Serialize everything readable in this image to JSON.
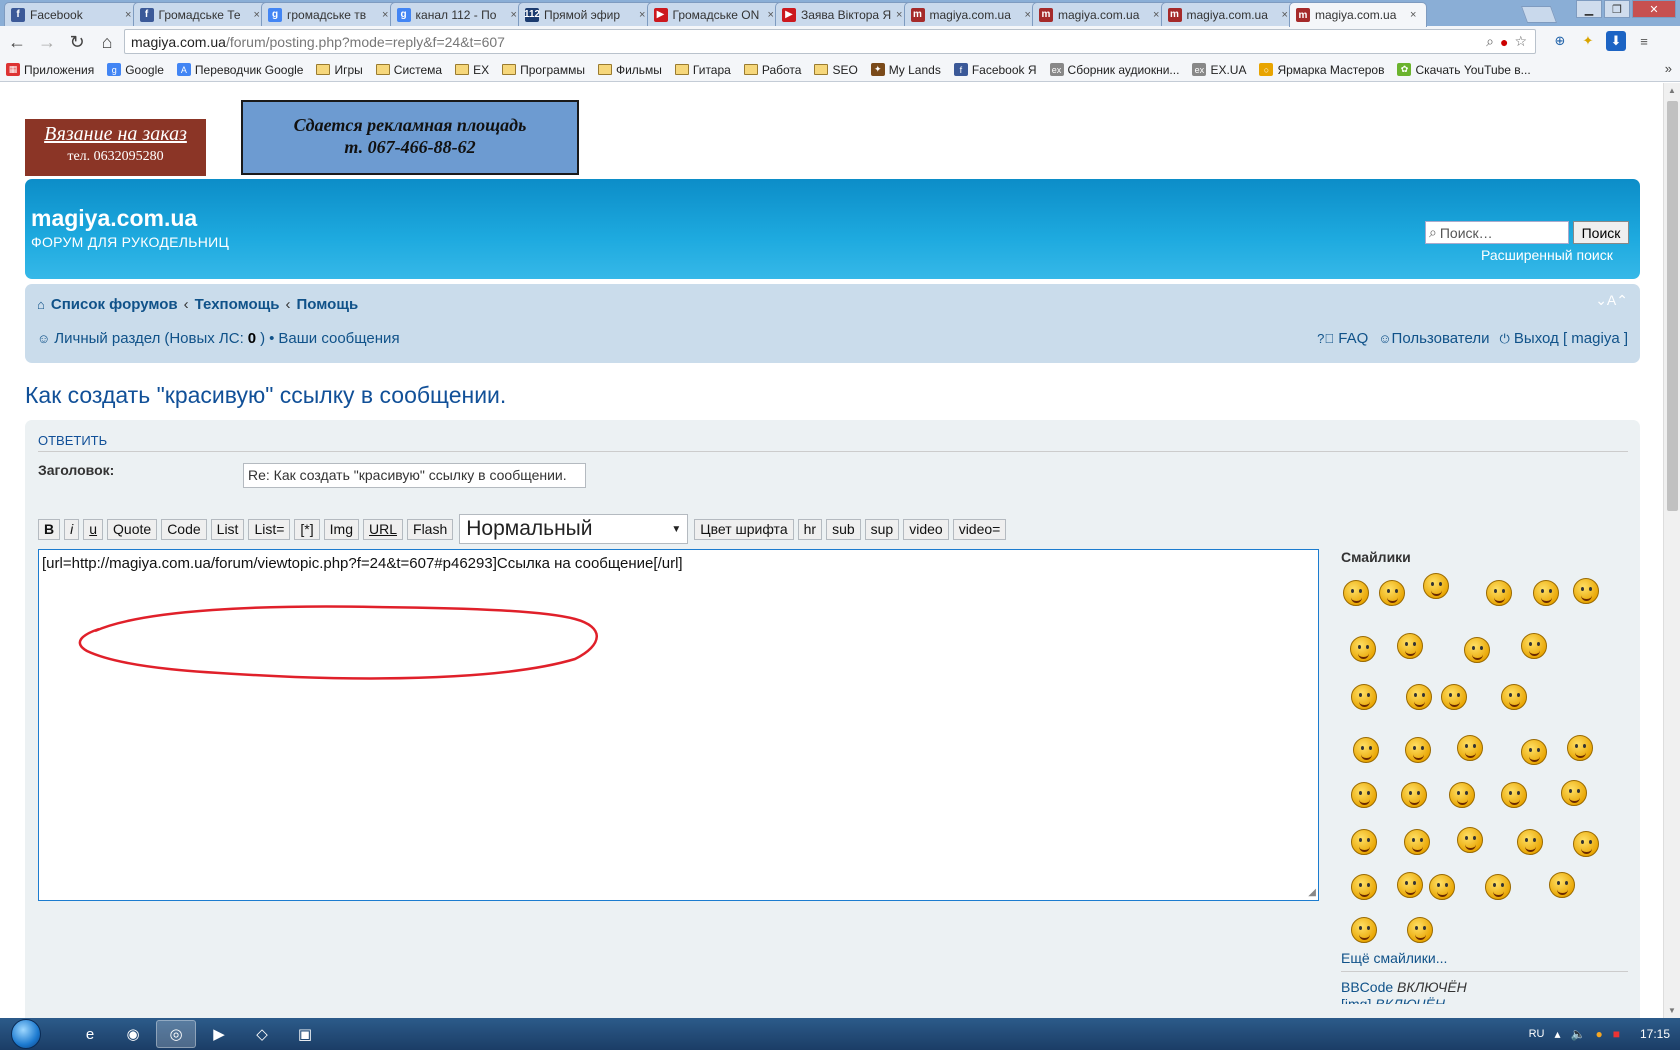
{
  "browser": {
    "tabs": [
      {
        "label": "Facebook",
        "icon": "facebook-icon",
        "color": "#3b5998",
        "glyph": "f"
      },
      {
        "label": "Громадське Те",
        "icon": "facebook-icon",
        "color": "#3b5998",
        "glyph": "f"
      },
      {
        "label": "громадське тв",
        "icon": "google-icon",
        "color": "#4285f4",
        "glyph": "g"
      },
      {
        "label": "канал 112 - По",
        "icon": "google-icon",
        "color": "#4285f4",
        "glyph": "g"
      },
      {
        "label": "Прямой эфир",
        "icon": "channel-112-icon",
        "color": "#1b3b6f",
        "glyph": "112"
      },
      {
        "label": "Громадське ON",
        "icon": "youtube-icon",
        "color": "#cc181e",
        "glyph": "▶"
      },
      {
        "label": "Заява Віктора Я",
        "icon": "youtube-icon",
        "color": "#cc181e",
        "glyph": "▶"
      },
      {
        "label": "magiya.com.ua",
        "icon": "magiya-icon",
        "color": "#a52a2a",
        "glyph": "m"
      },
      {
        "label": "magiya.com.ua",
        "icon": "magiya-icon",
        "color": "#a52a2a",
        "glyph": "m"
      },
      {
        "label": "magiya.com.ua",
        "icon": "magiya-icon",
        "color": "#a52a2a",
        "glyph": "m"
      },
      {
        "label": "magiya.com.ua",
        "icon": "magiya-icon",
        "color": "#a52a2a",
        "glyph": "m",
        "active": true
      }
    ],
    "address": {
      "host": "magiya.com.ua",
      "path": "/forum/posting.php?mode=reply&f=24&t=607"
    },
    "bookmarks": [
      {
        "label": "Приложения",
        "type": "apps"
      },
      {
        "label": "Google",
        "type": "google"
      },
      {
        "label": "Переводчик Google",
        "type": "translate"
      },
      {
        "label": "Игры",
        "type": "folder"
      },
      {
        "label": "Система",
        "type": "folder"
      },
      {
        "label": "EX",
        "type": "folder"
      },
      {
        "label": "Программы",
        "type": "folder"
      },
      {
        "label": "Фильмы",
        "type": "folder"
      },
      {
        "label": "Гитара",
        "type": "folder"
      },
      {
        "label": "Работа",
        "type": "folder"
      },
      {
        "label": "SEO",
        "type": "folder"
      },
      {
        "label": "My Lands",
        "type": "game"
      },
      {
        "label": "Facebook Я",
        "type": "facebook"
      },
      {
        "label": "Сборник аудиокни...",
        "type": "ex"
      },
      {
        "label": "EX.UA",
        "type": "ex"
      },
      {
        "label": "Ярмарка Мастеров",
        "type": "ring"
      },
      {
        "label": "Скачать YouTube в...",
        "type": "leaf"
      }
    ],
    "bookmarks_more": "»"
  },
  "ads": {
    "knit_title": "Вязание на заказ",
    "knit_phone": "тел. 0632095280",
    "space_line1": "Сдается рекламная площадь",
    "space_line2": "т. 067-466-88-62"
  },
  "header": {
    "site_name": "magiya.com.ua",
    "site_desc": "ФОРУМ ДЛЯ РУКОДЕЛЬНИЦ",
    "search_placeholder": "Поиск…",
    "search_button": "Поиск",
    "advanced_search": "Расширенный поиск"
  },
  "nav": {
    "breadcrumbs": [
      "Список форумов",
      "Техпомощь",
      "Помощь"
    ],
    "breadcrumb_sep": "‹",
    "font_size_control": "⌄A⌃",
    "personal": "Личный раздел",
    "new_pm_prefix": "(Новых ЛС: ",
    "new_pm_count": "0",
    "new_pm_suffix": ")",
    "bullet": "•",
    "your_posts": "Ваши сообщения",
    "faq": "FAQ",
    "members": "Пользователи",
    "logout": "Выход [ magiya ]"
  },
  "topic": {
    "title": "Как создать \"красивую\" ссылку в сообщении."
  },
  "posting": {
    "heading": "ОТВЕТИТЬ",
    "subject_label": "Заголовок:",
    "subject_value": "Re: Как создать \"красивую\" ссылку в сообщении.",
    "bbcode_buttons": [
      "B",
      "i",
      "u",
      "Quote",
      "Code",
      "List",
      "List=",
      "[*]",
      "Img",
      "URL",
      "Flash"
    ],
    "font_size_value": "Нормальный",
    "bbcode_buttons2": [
      "Цвет шрифта",
      "hr",
      "sub",
      "sup",
      "video",
      "video="
    ],
    "message": "[url=http://magiya.com.ua/forum/viewtopic.php?f=24&t=607#p46293]Ссылка на сообщение[/url]",
    "smilies_title": "Смайлики",
    "more_smilies": "Ещё смайлики...",
    "bbcode_label": "BBCode",
    "bbcode_state": "ВКЛЮЧЁН",
    "img_label": "[img]",
    "img_state": "ВКЛЮЧЁН"
  },
  "taskbar": {
    "apps": [
      {
        "name": "ie-icon",
        "glyph": "e"
      },
      {
        "name": "firefox-icon",
        "glyph": "◉"
      },
      {
        "name": "chrome-icon",
        "glyph": "◎",
        "active": true
      },
      {
        "name": "media-player-icon",
        "glyph": "▶"
      },
      {
        "name": "app-icon",
        "glyph": "◇"
      },
      {
        "name": "app-icon-2",
        "glyph": "▣"
      }
    ],
    "lang": "RU",
    "clock": "17:15"
  }
}
